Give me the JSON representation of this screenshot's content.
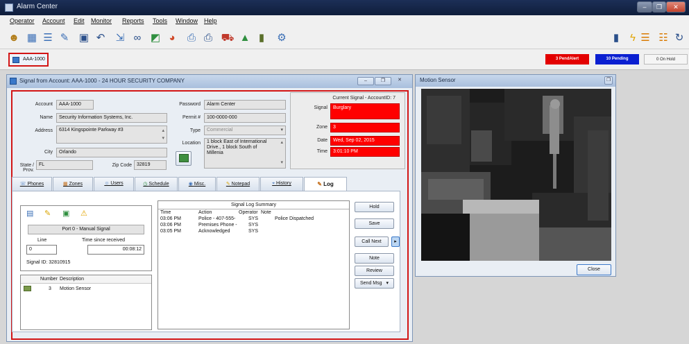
{
  "app": {
    "title": "Alarm Center",
    "window_controls": [
      "–",
      "❐",
      "✕"
    ]
  },
  "menu": [
    {
      "label": "Operator"
    },
    {
      "label": "Account"
    },
    {
      "label": "Edit"
    },
    {
      "label": "Monitor"
    },
    {
      "label": "Reports"
    },
    {
      "label": "Tools"
    },
    {
      "label": "Window"
    },
    {
      "label": "Help"
    }
  ],
  "toolbar_icons": [
    {
      "name": "operator-icon",
      "glyph": "☻",
      "color": "#b07a14"
    },
    {
      "name": "calendar-icon",
      "glyph": "▦",
      "color": "#3b6fb6"
    },
    {
      "name": "list-view-icon",
      "glyph": "☰",
      "color": "#3b6fb6"
    },
    {
      "name": "edit-icon",
      "glyph": "✎",
      "color": "#3b6fb6"
    },
    {
      "name": "save-icon",
      "glyph": "▣",
      "color": "#2a4f8a"
    },
    {
      "name": "undo-icon",
      "glyph": "↶",
      "color": "#2a4f8a"
    },
    {
      "name": "export-icon",
      "glyph": "⇲",
      "color": "#3b6fb6"
    },
    {
      "name": "binoculars-icon",
      "glyph": "∞",
      "color": "#2a4f8a"
    },
    {
      "name": "map-icon",
      "glyph": "◩",
      "color": "#2f8f3f"
    },
    {
      "name": "globe-icon",
      "glyph": "◕",
      "color": "#d04a2a"
    },
    {
      "name": "print-preview-icon",
      "glyph": "⎙",
      "color": "#3b6fb6"
    },
    {
      "name": "print-icon",
      "glyph": "⎙",
      "color": "#2a4f8a"
    },
    {
      "name": "truck-icon",
      "glyph": "⛟",
      "color": "#c0392b"
    },
    {
      "name": "dispatch-icon",
      "glyph": "▲",
      "color": "#2f8f3f"
    },
    {
      "name": "battery-icon",
      "glyph": "▮",
      "color": "#5a6f2a"
    },
    {
      "name": "settings-icon",
      "glyph": "⚙",
      "color": "#3b6fb6"
    }
  ],
  "right_toolbar_icons": [
    {
      "name": "phone-icon",
      "glyph": "▮",
      "color": "#2a4f8a"
    },
    {
      "name": "lightning-icon",
      "glyph": "ϟ",
      "color": "#e2a400"
    },
    {
      "name": "queue-icon",
      "glyph": "☰",
      "color": "#d97a00"
    },
    {
      "name": "report-icon",
      "glyph": "☷",
      "color": "#d97a00"
    },
    {
      "name": "refresh-icon",
      "glyph": "↻",
      "color": "#2a4f8a"
    }
  ],
  "account_tab": {
    "label": "AAA-1000"
  },
  "status": {
    "pending_alerts": {
      "label": "3 PendAlert",
      "color": "#e30000"
    },
    "pending": {
      "label": "10 Pending",
      "color": "#0a1fd1"
    },
    "on_hold": {
      "label": "0 On Hold"
    }
  },
  "signal_window": {
    "title": "Signal from Account: AAA-1000  -  24 HOUR SECURITY COMPANY",
    "labels": {
      "account": "Account",
      "name": "Name",
      "address": "Address",
      "city": "City",
      "state": "State / Prov.",
      "zip": "Zip Code",
      "password": "Password",
      "permit": "Permit #",
      "type": "Type",
      "location": "Location",
      "current_signal": "Current Signal - AccountID: 7",
      "signal": "Signal",
      "zone": "Zone",
      "date": "Date",
      "time": "Time"
    },
    "values": {
      "account": "AAA-1000",
      "name": "Security Information Systems, Inc.",
      "address": "6314 Kingspointe Parkway #3",
      "city": "Orlando",
      "state": "FL",
      "zip": "32819",
      "password": "Alarm Center",
      "permit": "100-0000-000",
      "type": "Commercial",
      "location": "1 block East of International Drive., 1 block South of Millenia",
      "signal": "Burglary",
      "zone": "3",
      "date": "Wed, Sep 02, 2015",
      "time": "3:01:10 PM"
    },
    "tabs": [
      {
        "label": "Phones"
      },
      {
        "label": "Zones"
      },
      {
        "label": "Users"
      },
      {
        "label": "Schedule"
      },
      {
        "label": "Misc."
      },
      {
        "label": "Notepad"
      },
      {
        "label": "History"
      },
      {
        "label": "Log"
      }
    ],
    "log": {
      "port": "Port 0 - Manual Signal",
      "line_label": "Line",
      "line_value": "0",
      "time_label": "Time since received",
      "time_value": "00:08:12",
      "signal_id": "Signal ID: 32810915",
      "zone_columns": [
        "Number",
        "Description"
      ],
      "zone_row": {
        "number": "3",
        "description": "Motion Sensor"
      },
      "summary_title": "Signal Log Summary",
      "columns": [
        "Time",
        "Action",
        "Operator",
        "Note"
      ],
      "rows": [
        {
          "time": "03:06 PM",
          "action": "Police  - 407-555-",
          "operator": "SYS",
          "note": "Police Dispatched"
        },
        {
          "time": "03:06 PM",
          "action": "Premises Phone  -",
          "operator": "SYS",
          "note": ""
        },
        {
          "time": "03:05 PM",
          "action": "Acknowledged",
          "operator": "SYS",
          "note": ""
        }
      ]
    },
    "buttons": {
      "hold": "Hold",
      "save": "Save",
      "call_next": "Call Next",
      "note": "Note",
      "review": "Review",
      "send_msg": "Send Msg",
      "arrow": "▸",
      "dropdown": "▾"
    }
  },
  "motion_window": {
    "title": "Motion Sensor",
    "close_label": "Close"
  }
}
